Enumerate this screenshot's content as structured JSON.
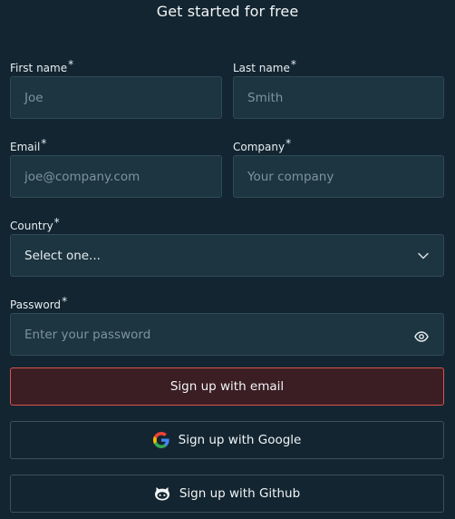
{
  "header": {
    "title": "Get started for free"
  },
  "form": {
    "first_name": {
      "label": "First name",
      "required": "*",
      "placeholder": "Joe"
    },
    "last_name": {
      "label": "Last name",
      "required": "*",
      "placeholder": "Smith"
    },
    "email": {
      "label": "Email",
      "required": "*",
      "placeholder": "joe@company.com"
    },
    "company": {
      "label": "Company",
      "required": "*",
      "placeholder": "Your company"
    },
    "country": {
      "label": "Country",
      "required": "*",
      "value": "Select one..."
    },
    "password": {
      "label": "Password",
      "required": "*",
      "placeholder": "Enter your password"
    }
  },
  "buttons": {
    "email": "Sign up with email",
    "google": "Sign up with Google",
    "github": "Sign up with Github"
  },
  "icons": {
    "dropdown": "chevron-down-icon",
    "password_toggle": "eye-icon",
    "google": "google-icon",
    "github": "github-icon"
  },
  "colors": {
    "background": "#132530",
    "input_bg": "#1d3540",
    "primary_border": "#d9534f",
    "primary_bg": "#3b1e24"
  }
}
